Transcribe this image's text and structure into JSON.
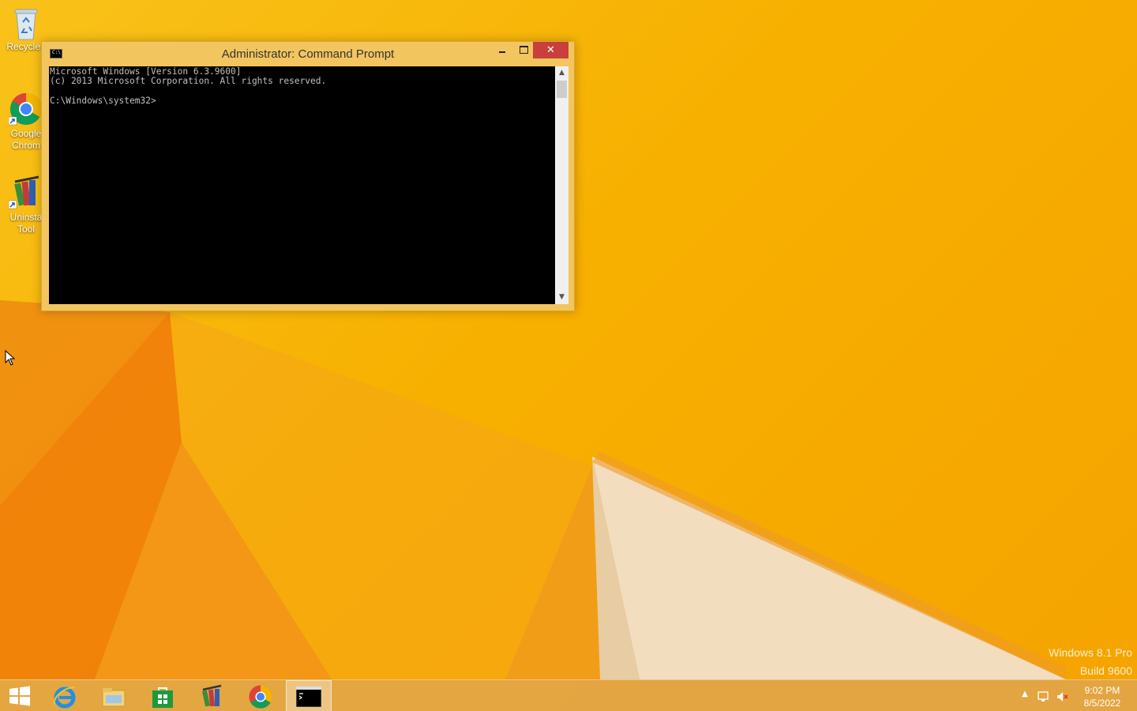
{
  "desktop": {
    "icons": [
      {
        "label": "Recycle Bin",
        "label_visible": "Recycle I",
        "icon": "recycle-bin-icon"
      },
      {
        "label_line1": "Google",
        "label_line2": "Chrom",
        "icon": "chrome-icon"
      },
      {
        "label_line1": "Uninsta",
        "label_line2": "Tool",
        "icon": "uninstall-tool-icon"
      }
    ],
    "watermark": {
      "line1": "Windows 8.1 Pro",
      "line2": "Build 9600"
    }
  },
  "window": {
    "title": "Administrator: Command Prompt",
    "title_icon_text": "C:\\",
    "controls": {
      "minimize": "minimize",
      "maximize": "maximize",
      "close": "✕"
    },
    "console_text": "Microsoft Windows [Version 6.3.9600]\n(c) 2013 Microsoft Corporation. All rights reserved.\n\nC:\\Windows\\system32>"
  },
  "taskbar": {
    "items": [
      {
        "name": "start-button",
        "icon": "windows-logo-icon"
      },
      {
        "name": "internet-explorer",
        "icon": "internet-explorer-icon"
      },
      {
        "name": "file-explorer",
        "icon": "file-explorer-icon"
      },
      {
        "name": "store",
        "icon": "store-icon"
      },
      {
        "name": "uninstall-tool",
        "icon": "uninstall-tool-icon"
      },
      {
        "name": "google-chrome",
        "icon": "chrome-icon"
      },
      {
        "name": "command-prompt",
        "icon": "command-prompt-icon",
        "active": true
      }
    ],
    "tray": {
      "time": "9:02 PM",
      "date": "8/5/2022",
      "icons": [
        "show-hidden-icons-icon",
        "network-icon",
        "volume-muted-icon"
      ]
    }
  },
  "colors": {
    "window_frame": "#f3c55f",
    "close_button": "#c7403b",
    "console_bg": "#000000",
    "console_fg": "#c0c0c0"
  }
}
